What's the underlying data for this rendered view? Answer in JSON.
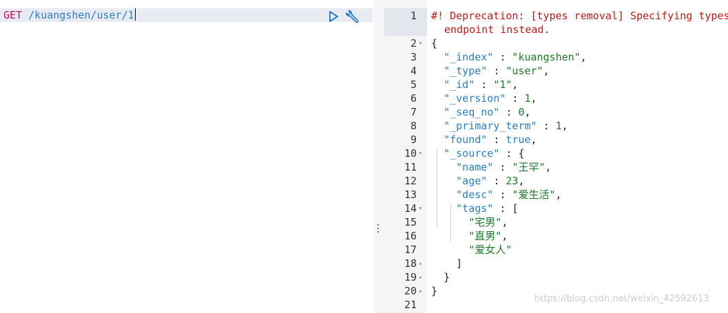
{
  "request": {
    "method": "GET",
    "path": "/kuangshen/user/1"
  },
  "toolbar": {
    "run_icon": "play-icon",
    "settings_icon": "wrench-icon"
  },
  "response": {
    "warning_line1": "#! Deprecation: [types removal] Specifying types in document get requests is deprecated, use the /{index}/_doc/{id} endpoint instead.",
    "warning_line2": "endpoint instead.",
    "lines": [
      "{",
      "\"_index\" : \"kuangshen\",",
      "\"_type\" : \"user\",",
      "\"_id\" : \"1\",",
      "\"_version\" : 1,",
      "\"_seq_no\" : 0,",
      "\"_primary_term\" : 1,",
      "\"found\" : true,",
      "\"_source\" : {",
      "\"name\" : \"王罕\",",
      "\"age\" : 23,",
      "\"desc\" : \"爱生活\",",
      "\"tags\" : [",
      "\"宅男\",",
      "\"直男\",",
      "\"爱女人\"",
      "]",
      "}",
      "}",
      ""
    ],
    "line_numbers": [
      "1",
      "2",
      "3",
      "4",
      "5",
      "6",
      "7",
      "8",
      "9",
      "10",
      "11",
      "12",
      "13",
      "14",
      "15",
      "16",
      "17",
      "18",
      "19",
      "20",
      "21"
    ]
  },
  "watermark": "https://blog.csdn.net/weixin_42592613"
}
